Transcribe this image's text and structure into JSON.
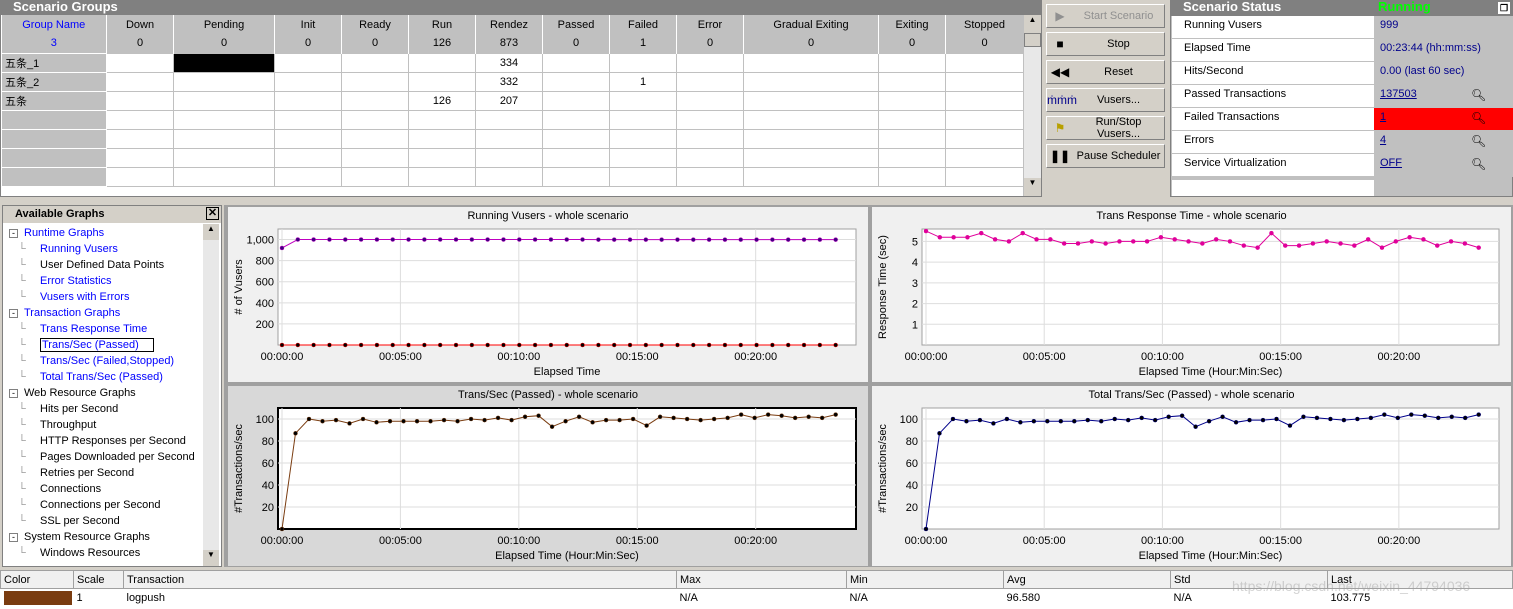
{
  "groups": {
    "title": "Scenario Groups",
    "headers": [
      "Group Name",
      "Down",
      "Pending",
      "Init",
      "Ready",
      "Run",
      "Rendez",
      "Passed",
      "Failed",
      "Error",
      "Gradual Exiting",
      "Exiting",
      "Stopped"
    ],
    "totals": [
      "3",
      "0",
      "0",
      "0",
      "0",
      "126",
      "873",
      "0",
      "1",
      "0",
      "0",
      "0",
      "0"
    ],
    "rows": [
      [
        "五条_1",
        "",
        "",
        "",
        "",
        "",
        "334",
        "",
        "",
        "",
        "",
        "",
        ""
      ],
      [
        "五条_2",
        "",
        "",
        "",
        "",
        "",
        "332",
        "",
        "1",
        "",
        "",
        "",
        ""
      ],
      [
        "五条",
        "",
        "",
        "",
        "",
        "126",
        "207",
        "",
        "",
        "",
        "",
        "",
        ""
      ]
    ]
  },
  "buttons": {
    "start": "Start Scenario",
    "stop": "Stop",
    "reset": "Reset",
    "vusers": "Vusers...",
    "runstop": "Run/Stop Vusers...",
    "pause": "Pause Scheduler"
  },
  "status": {
    "title": "Scenario Status",
    "state": "Running",
    "rows": [
      {
        "k": "Running Vusers",
        "v": "999"
      },
      {
        "k": "Elapsed Time",
        "v": "00:23:44 (hh:mm:ss)"
      },
      {
        "k": "Hits/Second",
        "v": "0.00 (last 60 sec)"
      },
      {
        "k": "Passed Transactions",
        "v": "137503"
      },
      {
        "k": "Failed Transactions",
        "v": "1"
      },
      {
        "k": "Errors",
        "v": "4"
      },
      {
        "k": "Service Virtualization",
        "v": "OFF"
      }
    ]
  },
  "graphs_panel": {
    "title": "Available Graphs",
    "items": [
      {
        "label": "Runtime Graphs",
        "level": 0,
        "link": true
      },
      {
        "label": "Running Vusers",
        "level": 1,
        "link": true
      },
      {
        "label": "User Defined Data Points",
        "level": 1
      },
      {
        "label": "Error Statistics",
        "level": 1,
        "link": true
      },
      {
        "label": "Vusers with Errors",
        "level": 1,
        "link": true
      },
      {
        "label": "Transaction Graphs",
        "level": 0,
        "link": true
      },
      {
        "label": "Trans Response Time",
        "level": 1,
        "link": true
      },
      {
        "label": "Trans/Sec (Passed)",
        "level": 1,
        "link": true,
        "selected": true
      },
      {
        "label": "Trans/Sec (Failed,Stopped)",
        "level": 1,
        "link": true
      },
      {
        "label": "Total Trans/Sec (Passed)",
        "level": 1,
        "link": true
      },
      {
        "label": "Web Resource Graphs",
        "level": 0
      },
      {
        "label": "Hits per Second",
        "level": 1
      },
      {
        "label": "Throughput",
        "level": 1
      },
      {
        "label": "HTTP Responses per Second",
        "level": 1
      },
      {
        "label": "Pages Downloaded per Second",
        "level": 1
      },
      {
        "label": "Retries per Second",
        "level": 1
      },
      {
        "label": "Connections",
        "level": 1
      },
      {
        "label": "Connections per Second",
        "level": 1
      },
      {
        "label": "SSL per Second",
        "level": 1
      },
      {
        "label": "System Resource Graphs",
        "level": 0
      },
      {
        "label": "Windows Resources",
        "level": 1
      }
    ]
  },
  "chart_data": [
    {
      "type": "line",
      "title": "Running Vusers - whole scenario",
      "xlabel": "Elapsed Time",
      "ylabel": "# of Vusers",
      "ylim": [
        0,
        1100
      ],
      "yticks": [
        200,
        400,
        600,
        800,
        1000
      ],
      "ytick_labels": [
        "200",
        "400",
        "600",
        "800",
        "1,000"
      ],
      "xticks": [
        "00:00:00",
        "00:05:00",
        "00:10:00",
        "00:15:00",
        "00:20:00"
      ],
      "xlim": [
        "00:00:00",
        "00:23:44"
      ],
      "grid": true,
      "series": [
        {
          "color": "#c000c0",
          "values": [
            920,
            1000,
            1000,
            1000,
            1000,
            1000,
            1000,
            1000,
            1000,
            1000,
            1000,
            1000,
            1000,
            1000,
            1000,
            1000,
            1000,
            1000,
            1000,
            1000,
            999,
            999,
            999,
            999,
            999,
            999,
            999,
            999,
            999,
            999,
            999,
            999,
            999,
            999,
            999,
            999
          ]
        },
        {
          "color": "#ff0000",
          "values": [
            0,
            0,
            0,
            0,
            0,
            0,
            0,
            0,
            0,
            0,
            0,
            0,
            0,
            0,
            0,
            0,
            0,
            0,
            0,
            0,
            0,
            0,
            0,
            0,
            0,
            0,
            0,
            0,
            0,
            0,
            0,
            0,
            0,
            0,
            0,
            0
          ]
        }
      ]
    },
    {
      "type": "line",
      "title": "Trans Response Time - whole scenario",
      "xlabel": "Elapsed Time (Hour:Min:Sec)",
      "ylabel": "Response Time (sec)",
      "ylim": [
        0,
        5.6
      ],
      "yticks": [
        1,
        2,
        3,
        4,
        5
      ],
      "ytick_labels": [
        "1",
        "2",
        "3",
        "4",
        "5"
      ],
      "xticks": [
        "00:00:00",
        "00:05:00",
        "00:10:00",
        "00:15:00",
        "00:20:00"
      ],
      "xlim": [
        "00:00:00",
        "00:23:44"
      ],
      "grid": true,
      "series": [
        {
          "color": "#e0009a",
          "values": [
            5.5,
            5.2,
            5.2,
            5.2,
            5.4,
            5.1,
            5.0,
            5.4,
            5.1,
            5.1,
            4.9,
            4.9,
            5.0,
            4.9,
            5.0,
            5.0,
            5.0,
            5.2,
            5.1,
            5.0,
            4.9,
            5.1,
            5.0,
            4.8,
            4.7,
            5.4,
            4.8,
            4.8,
            4.9,
            5.0,
            4.9,
            4.8,
            5.1,
            4.7,
            5.0,
            5.2,
            5.1,
            4.8,
            5.0,
            4.9,
            4.7
          ]
        }
      ]
    },
    {
      "type": "line",
      "title": "Trans/Sec (Passed) - whole scenario",
      "xlabel": "Elapsed Time (Hour:Min:Sec)",
      "ylabel": "#Transactions/sec",
      "ylim": [
        0,
        110
      ],
      "yticks": [
        20,
        40,
        60,
        80,
        100
      ],
      "ytick_labels": [
        "20",
        "40",
        "60",
        "80",
        "100"
      ],
      "xticks": [
        "00:00:00",
        "00:05:00",
        "00:10:00",
        "00:15:00",
        "00:20:00"
      ],
      "xlim": [
        "00:00:00",
        "00:23:44"
      ],
      "grid": true,
      "series": [
        {
          "color": "#7a3c10",
          "values": [
            0,
            87,
            100,
            98,
            99,
            96,
            100,
            97,
            98,
            98,
            98,
            98,
            99,
            98,
            100,
            99,
            101,
            99,
            102,
            103,
            93,
            98,
            102,
            97,
            99,
            99,
            100,
            94,
            102,
            101,
            100,
            99,
            100,
            101,
            104,
            101,
            104,
            103,
            101,
            102,
            101,
            104
          ]
        }
      ]
    },
    {
      "type": "line",
      "title": "Total Trans/Sec (Passed) - whole scenario",
      "xlabel": "Elapsed Time (Hour:Min:Sec)",
      "ylabel": "#Transactions/sec",
      "ylim": [
        0,
        110
      ],
      "yticks": [
        20,
        40,
        60,
        80,
        100
      ],
      "ytick_labels": [
        "20",
        "40",
        "60",
        "80",
        "100"
      ],
      "xticks": [
        "00:00:00",
        "00:05:00",
        "00:10:00",
        "00:15:00",
        "00:20:00"
      ],
      "xlim": [
        "00:00:00",
        "00:23:44"
      ],
      "grid": true,
      "series": [
        {
          "color": "#00008b",
          "values": [
            0,
            87,
            100,
            98,
            99,
            96,
            100,
            97,
            98,
            98,
            98,
            98,
            99,
            98,
            100,
            99,
            101,
            99,
            102,
            103,
            93,
            98,
            102,
            97,
            99,
            99,
            100,
            94,
            102,
            101,
            100,
            99,
            100,
            101,
            104,
            101,
            104,
            103,
            101,
            102,
            101,
            104
          ]
        }
      ]
    }
  ],
  "legend_table": {
    "headers": [
      "Color",
      "Scale",
      "Transaction",
      "Max",
      "Min",
      "Avg",
      "Std",
      "Last"
    ],
    "row": {
      "color": "#7a3c10",
      "scale": "1",
      "transaction": "logpush",
      "max": "N/A",
      "min": "N/A",
      "avg": "96.580",
      "std": "N/A",
      "last": "103.775"
    }
  },
  "watermark": "https://blog.csdn.net/weixin_44794036"
}
